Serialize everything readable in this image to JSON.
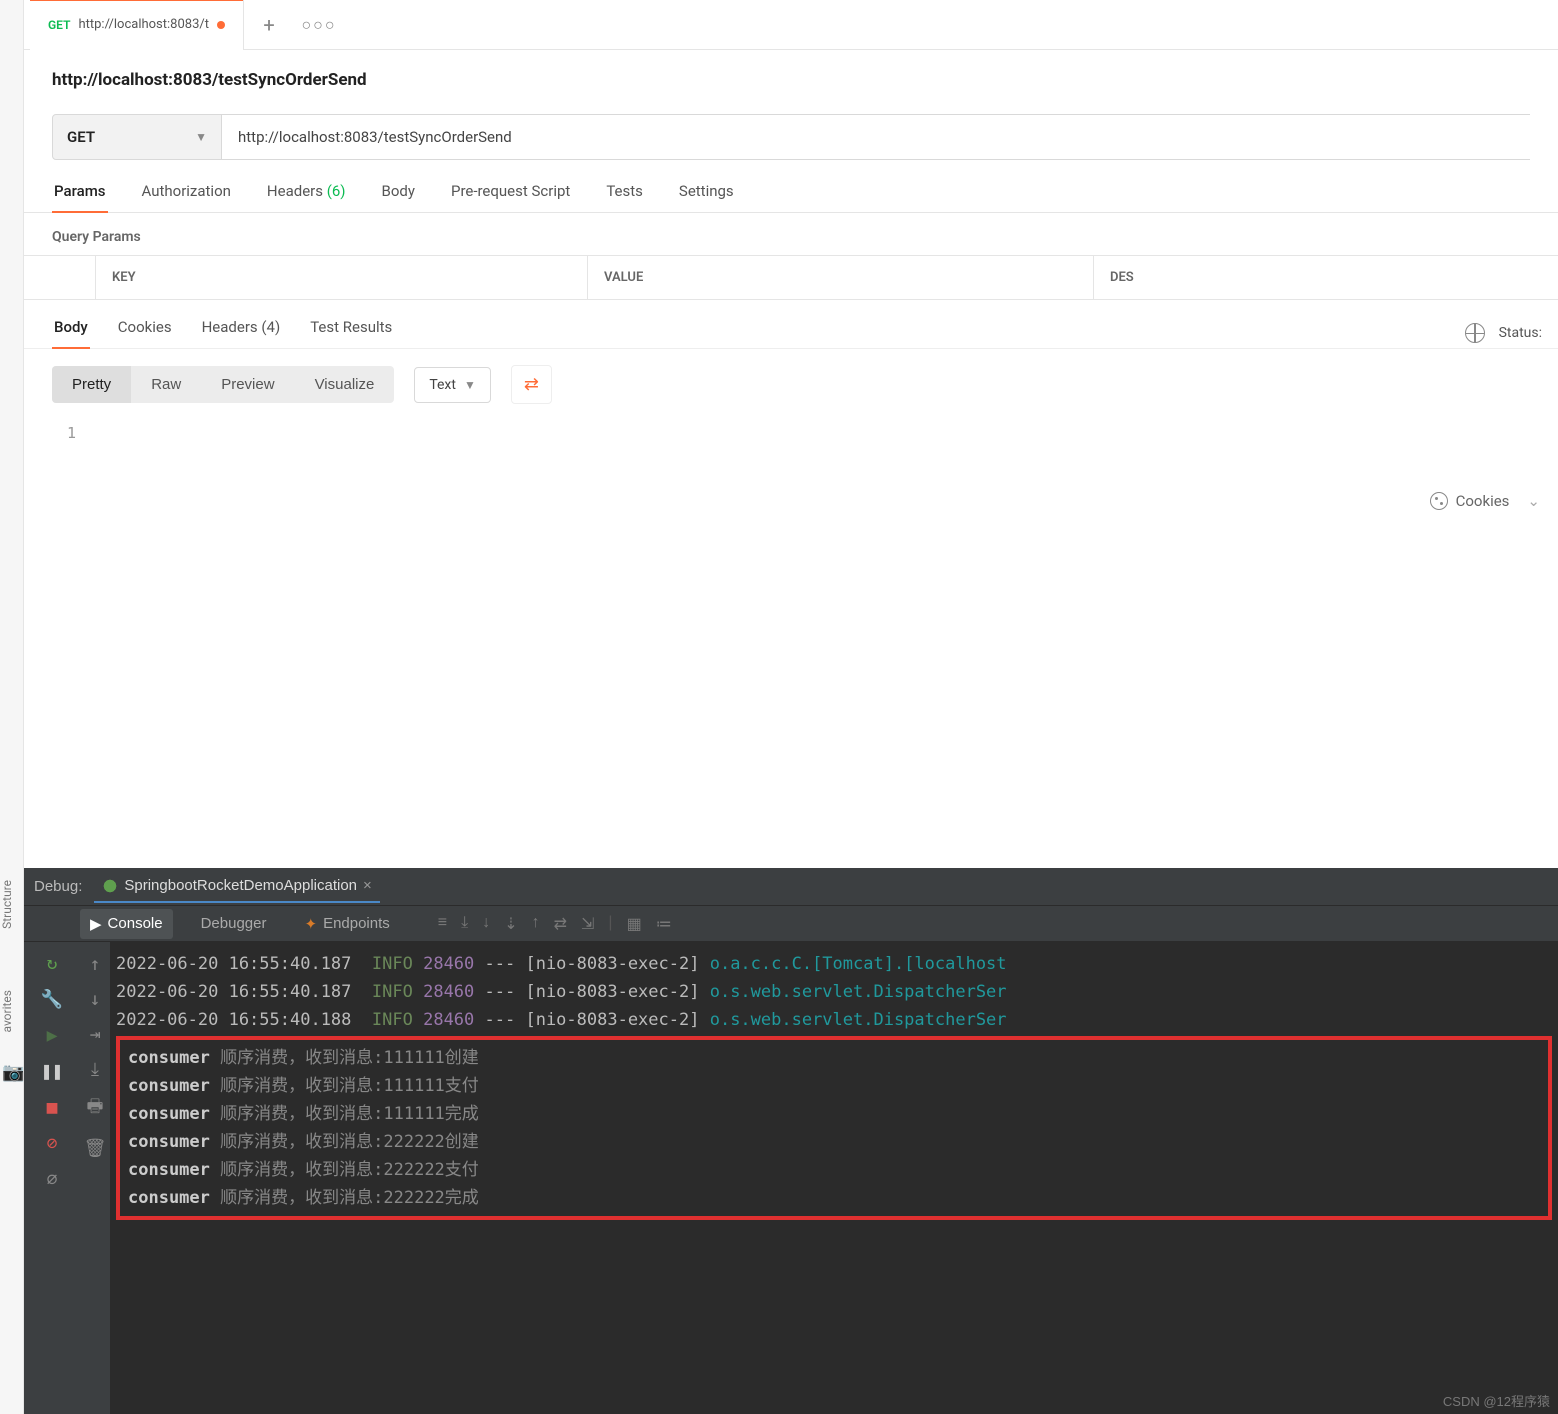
{
  "sidebar": {
    "structure": "Structure",
    "favorites": "avorites"
  },
  "tabs": {
    "active": {
      "method": "GET",
      "name": "http://localhost:8083/t"
    }
  },
  "request": {
    "title": "http://localhost:8083/testSyncOrderSend",
    "method": "GET",
    "url": "http://localhost:8083/testSyncOrderSend",
    "tabs": {
      "params": "Params",
      "authorization": "Authorization",
      "headers": "Headers",
      "headers_count": "(6)",
      "body": "Body",
      "prerequest": "Pre-request Script",
      "tests": "Tests",
      "settings": "Settings"
    },
    "query_params_label": "Query Params",
    "cols": {
      "key": "KEY",
      "value": "VALUE",
      "description": "DES"
    }
  },
  "response": {
    "tabs": {
      "body": "Body",
      "cookies": "Cookies",
      "headers": "Headers",
      "headers_count": "(4)",
      "test_results": "Test Results"
    },
    "status_label": "Status:",
    "format": {
      "pretty": "Pretty",
      "raw": "Raw",
      "preview": "Preview",
      "visualize": "Visualize",
      "type": "Text"
    },
    "lines": [
      "1"
    ],
    "footer_cookies": "Cookies"
  },
  "ide": {
    "debug_label": "Debug:",
    "run_config": "SpringbootRocketDemoApplication",
    "tabs": {
      "console": "Console",
      "debugger": "Debugger",
      "endpoints": "Endpoints"
    },
    "log_lines": [
      {
        "ts": "2022-06-20 16:55:40.187",
        "lvl": "INFO",
        "pid": "28460",
        "thr": "[nio-8083-exec-2]",
        "cls": "o.a.c.c.C.[Tomcat].[localhost"
      },
      {
        "ts": "2022-06-20 16:55:40.187",
        "lvl": "INFO",
        "pid": "28460",
        "thr": "[nio-8083-exec-2]",
        "cls": "o.s.web.servlet.DispatcherSer"
      },
      {
        "ts": "2022-06-20 16:55:40.188",
        "lvl": "INFO",
        "pid": "28460",
        "thr": "[nio-8083-exec-2]",
        "cls": "o.s.web.servlet.DispatcherSer"
      }
    ],
    "consumer_lines": [
      "顺序消费，收到消息:111111创建",
      "顺序消费，收到消息:111111支付",
      "顺序消费，收到消息:111111完成",
      "顺序消费，收到消息:222222创建",
      "顺序消费，收到消息:222222支付",
      "顺序消费，收到消息:222222完成"
    ],
    "consumer_tag": "consumer",
    "watermark": "CSDN @12程序猿"
  }
}
